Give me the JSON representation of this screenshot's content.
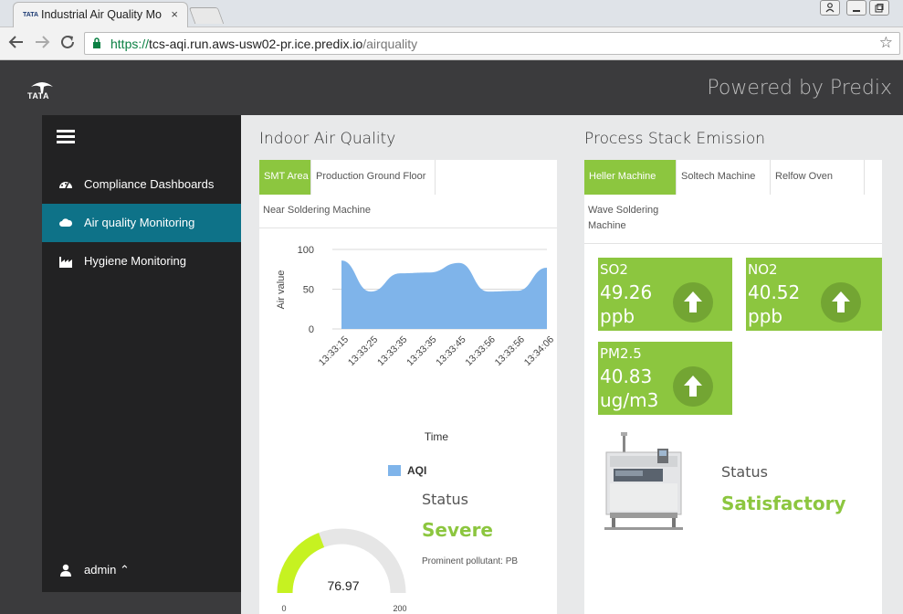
{
  "browser": {
    "tab_title": "Industrial Air Quality Mo",
    "tab_favicon": "TATA",
    "close_glyph": "×",
    "url_scheme": "https://",
    "url_host": "tcs-aqi.run.aws-usw02-pr.ice.predix.io",
    "url_path": "/airquality",
    "icons": [
      "back-arrow-icon",
      "forward-arrow-icon",
      "reload-icon",
      "lock-icon",
      "star-icon",
      "user-icon",
      "minimize-icon",
      "maximize-icon"
    ]
  },
  "header": {
    "logo_text": "TATA",
    "powered_by": "Powered by Predix"
  },
  "sidebar": {
    "items": [
      {
        "label": "Compliance Dashboards",
        "icon": "dashboard-icon"
      },
      {
        "label": "Air quality Monitoring",
        "icon": "cloud-icon",
        "active": true
      },
      {
        "label": "Hygiene Monitoring",
        "icon": "factory-icon"
      }
    ],
    "user": {
      "label": "admin",
      "icon": "user-icon",
      "caret": "⌃"
    }
  },
  "iaq": {
    "title": "Indoor Air Quality",
    "tabs": [
      "SMT Area",
      "Production Ground Floor",
      "Near Soldering Machine"
    ],
    "active_tab": 0,
    "status_label": "Status",
    "status_value": "Severe",
    "pollutant": "Prominent pollutant: PB",
    "gauge": {
      "value": "76.97",
      "min": "0",
      "max": "200",
      "value_num": 76.97,
      "max_num": 200,
      "fill_color": "#c6f221",
      "track_color": "#e6e6e6"
    }
  },
  "chart_data": {
    "type": "area",
    "title": "",
    "xlabel": "Time",
    "ylabel": "Air value",
    "ylim": [
      0,
      100
    ],
    "yticks": [
      "100",
      "50",
      "0"
    ],
    "x": [
      "13:33:15",
      "13:33:25",
      "13:33:35",
      "13:33:35",
      "13:33:45",
      "13:33:56",
      "13:33:56",
      "13:34:06"
    ],
    "series": [
      {
        "name": "AQI",
        "values": [
          86,
          47,
          70,
          71,
          83,
          47,
          48,
          77
        ],
        "color": "#7fb4ea"
      }
    ],
    "legend": "bottom",
    "grid": true
  },
  "pse": {
    "title": "Process Stack Emission",
    "tabs": [
      "Heller Machine",
      "Soltech Machine",
      "Relfow Oven",
      "Wave Soldering Machine"
    ],
    "active_tab": 0,
    "tiles": [
      {
        "name": "SO2",
        "value": "49.26",
        "unit": "ppb",
        "icon": "arrow-up-icon"
      },
      {
        "name": "NO2",
        "value": "40.52",
        "unit": "ppb",
        "icon": "arrow-up-icon"
      },
      {
        "name": "PM2.5",
        "value": "40.83",
        "unit": "ug/m3",
        "icon": "arrow-up-icon"
      }
    ],
    "status_label": "Status",
    "status_value": "Satisfactory"
  },
  "colors": {
    "accent_green": "#8cc63f",
    "sidebar_active": "#0e7288"
  }
}
